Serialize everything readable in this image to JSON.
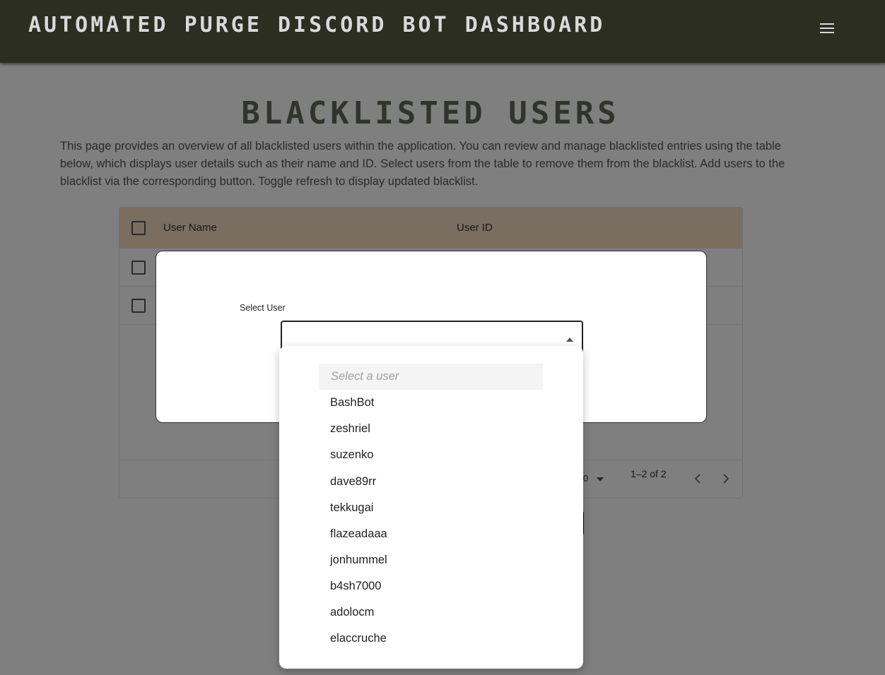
{
  "header": {
    "app_title": "AUTOMATED PURGE DISCORD BOT DASHBOARD",
    "menu_icon": "hamburger-menu-icon"
  },
  "page": {
    "title": "BLACKLISTED USERS",
    "description": "This page provides an overview of all blacklisted users within the application. You can review and manage blacklisted entries using the table below, which displays user details such as their name and ID. Select users from the table to remove them from the blacklist. Add users to the blacklist via the corresponding button. Toggle refresh to display updated blacklist."
  },
  "table": {
    "columns": [
      "User Name",
      "User ID"
    ],
    "rows_per_page_value": "0",
    "pagination_text": "1–2 of 2"
  },
  "dialog": {
    "select_label": "Select User",
    "dropdown": {
      "placeholder": "Select a user",
      "options": [
        "BashBot",
        "zeshriel",
        "suzenko",
        "dave89rr",
        "tekkugai",
        "flazeadaaa",
        "jonhummel",
        "b4sh7000",
        "adolocm",
        "elaccruche"
      ]
    }
  },
  "colors": {
    "header_bg": "#2c2e22",
    "table_header_bg": "#f3dcc0",
    "title_color": "#5f6b5a"
  }
}
